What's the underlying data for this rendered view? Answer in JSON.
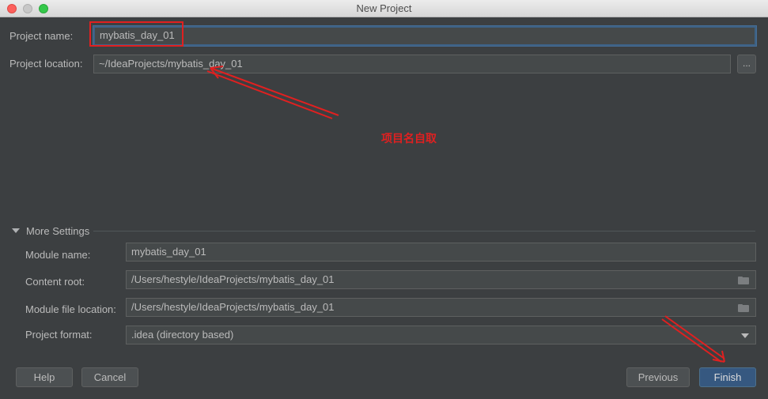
{
  "window": {
    "title": "New Project"
  },
  "project": {
    "name_label": "Project name:",
    "name_value": "mybatis_day_01",
    "location_label": "Project location:",
    "location_value": "~/IdeaProjects/mybatis_day_01",
    "browse_label": "..."
  },
  "annotation": {
    "note": "项目名自取"
  },
  "more_settings": {
    "header": "More Settings",
    "module_name_label": "Module name:",
    "module_name_value": "mybatis_day_01",
    "content_root_label": "Content root:",
    "content_root_value": "/Users/hestyle/IdeaProjects/mybatis_day_01",
    "module_file_label": "Module file location:",
    "module_file_value": "/Users/hestyle/IdeaProjects/mybatis_day_01",
    "format_label": "Project format:",
    "format_value": ".idea (directory based)"
  },
  "buttons": {
    "help": "Help",
    "cancel": "Cancel",
    "previous": "Previous",
    "finish": "Finish"
  },
  "colors": {
    "background": "#3c3f41",
    "annotation": "#e02020",
    "primary_button": "#365880",
    "focus_border": "#3d6185"
  }
}
